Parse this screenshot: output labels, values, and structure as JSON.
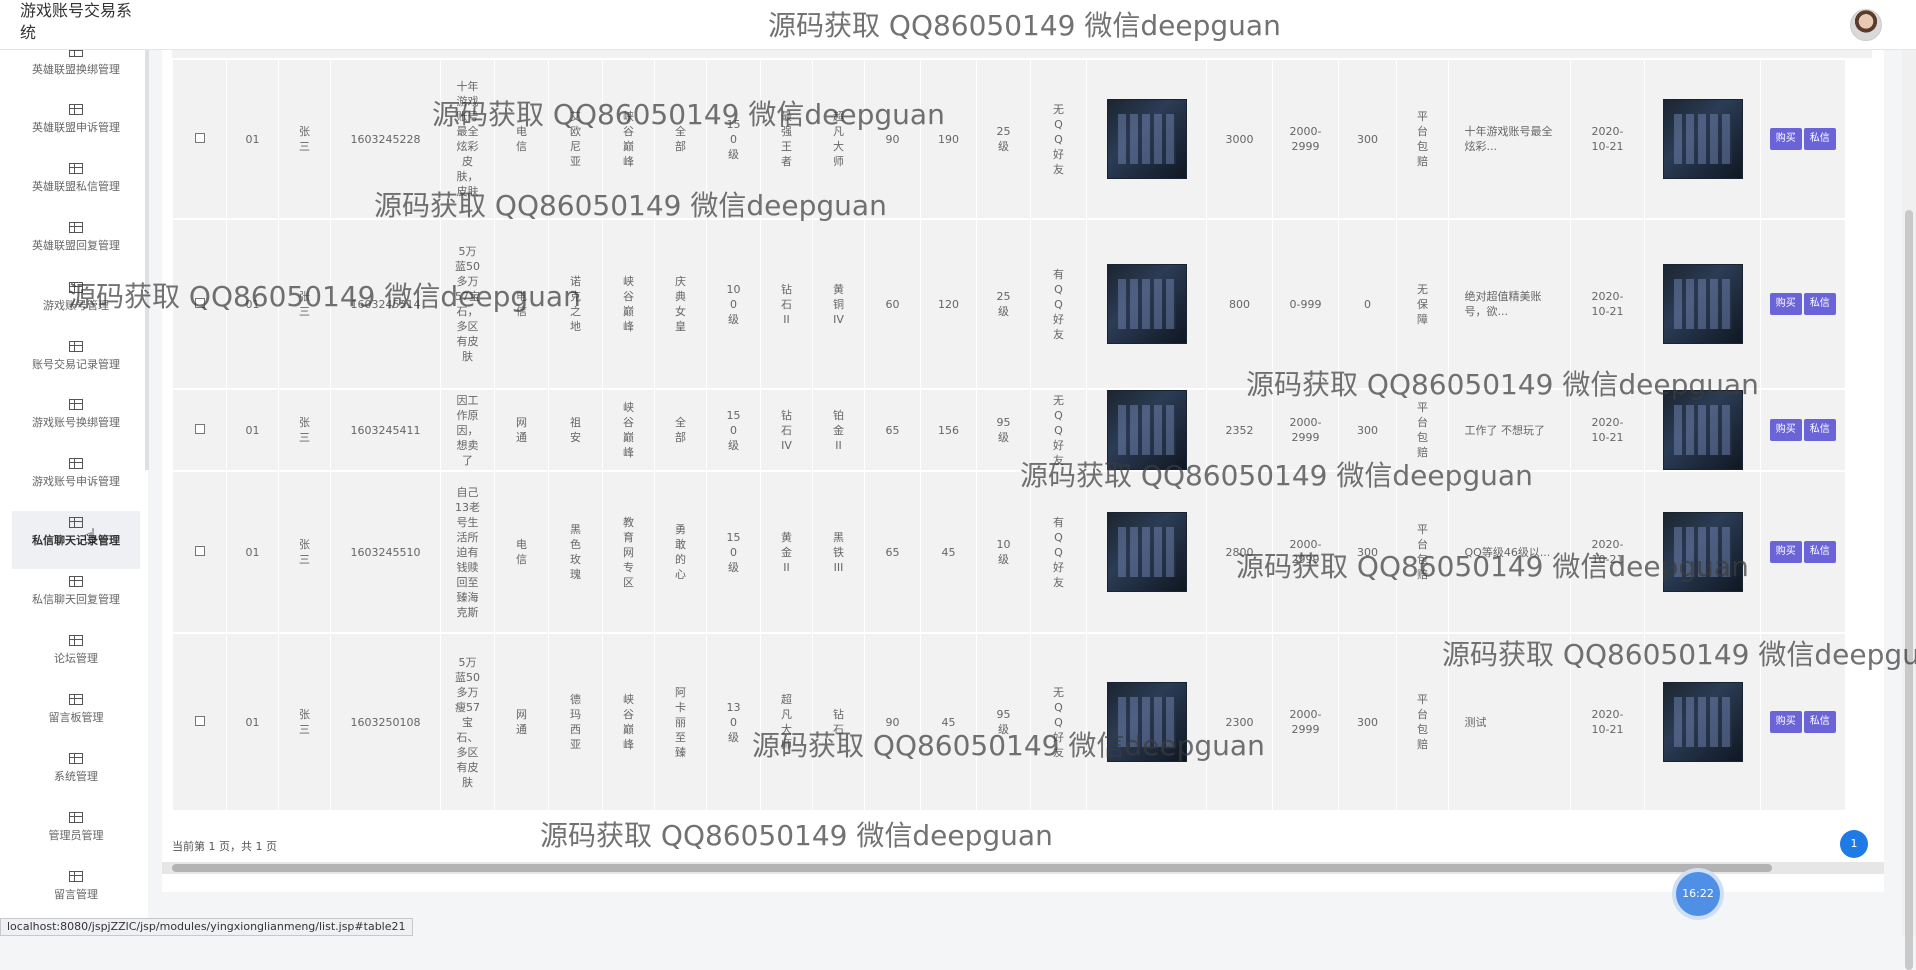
{
  "app": {
    "title": "游戏账号交易系统"
  },
  "watermark": "源码获取 QQ86050149 微信deepguan",
  "sidebar": {
    "items": [
      {
        "label": "英雄联盟换绑管理"
      },
      {
        "label": "英雄联盟申诉管理"
      },
      {
        "label": "英雄联盟私信管理"
      },
      {
        "label": "英雄联盟回复管理"
      },
      {
        "label": "游戏账号管理"
      },
      {
        "label": "账号交易记录管理"
      },
      {
        "label": "游戏账号换绑管理"
      },
      {
        "label": "游戏账号申诉管理"
      },
      {
        "label": "私信聊天记录管理"
      },
      {
        "label": "私信聊天回复管理"
      },
      {
        "label": "论坛管理"
      },
      {
        "label": "留言板管理"
      },
      {
        "label": "系统管理"
      },
      {
        "label": "管理员管理"
      },
      {
        "label": "留言管理"
      }
    ],
    "active_index": 8
  },
  "table": {
    "rows": [
      {
        "no": "01",
        "user": "张三",
        "phone": "1603245228",
        "title": "十年游戏账号最全炫彩皮肤，皮肤",
        "net": "电信",
        "area": "艾欧尼亚",
        "map": "峡谷巅峰",
        "hero": "全部",
        "level": "150级",
        "rank1": "最强王者",
        "rank2": "超凡大师",
        "num1": "90",
        "num2": "190",
        "rune": "25级",
        "friend": "无QQ好友",
        "price": "3000",
        "range": "2000-2999",
        "deposit": "300",
        "guarantee": "平台包赔",
        "desc": "十年游戏账号最全炫彩...",
        "date": "2020-10-21"
      },
      {
        "no": "01",
        "user": "张三",
        "phone": "1603245314",
        "title": "5万蓝50多万57宝石，多区有皮肤",
        "net": "电信",
        "area": "诺克之地",
        "map": "峡谷巅峰",
        "hero": "庆典女皇",
        "level": "100级",
        "rank1": "钻石II",
        "rank2": "黄铜IV",
        "num1": "60",
        "num2": "120",
        "rune": "25级",
        "friend": "有QQ好友",
        "price": "800",
        "range": "0-999",
        "deposit": "0",
        "guarantee": "无保障",
        "desc": "绝对超值精美账号，欲...",
        "date": "2020-10-21"
      },
      {
        "no": "01",
        "user": "张三",
        "phone": "1603245411",
        "title": "因工作原因，想卖了",
        "net": "网通",
        "area": "祖安",
        "map": "峡谷巅峰",
        "hero": "全部",
        "level": "150级",
        "rank1": "钻石IV",
        "rank2": "铂金II",
        "num1": "65",
        "num2": "156",
        "rune": "95级",
        "friend": "无QQ好友",
        "price": "2352",
        "range": "2000-2999",
        "deposit": "300",
        "guarantee": "平台包赔",
        "desc": "工作了 不想玩了",
        "date": "2020-10-21"
      },
      {
        "no": "01",
        "user": "张三",
        "phone": "1603245510",
        "title": "自己13老号生活所迫有钱赎回至臻海克斯",
        "net": "电信",
        "area": "黑色玫瑰",
        "map": "教育网专区",
        "hero": "勇敢的心",
        "level": "150级",
        "rank1": "黄金II",
        "rank2": "黑铁III",
        "num1": "65",
        "num2": "45",
        "rune": "10级",
        "friend": "有QQ好友",
        "price": "2800",
        "range": "2000-2999",
        "deposit": "300",
        "guarantee": "平台包赔",
        "desc": "QQ等级46级以...",
        "date": "2020-10-21"
      },
      {
        "no": "01",
        "user": "张三",
        "phone": "1603250108",
        "title": "5万蓝50多万瘦57宝石、多区有皮肤",
        "net": "网通",
        "area": "德玛西亚",
        "map": "峡谷巅峰",
        "hero": "阿卡丽至臻",
        "level": "130级",
        "rank1": "超凡大师",
        "rank2": "钻石",
        "num1": "90",
        "num2": "45",
        "rune": "95级",
        "friend": "无QQ好友",
        "price": "2300",
        "range": "2000-2999",
        "deposit": "300",
        "guarantee": "平台包赔",
        "desc": "测试",
        "date": "2020-10-21"
      }
    ],
    "buy_label": "购买",
    "msg_label": "私信"
  },
  "footer": {
    "page_info": "当前第 1 页，共 1 页",
    "page_number": "1"
  },
  "clock": "16:22",
  "status_url": "localhost:8080/jspjZZlC/jsp/modules/yingxionglianmeng/list.jsp#table21",
  "colors": {
    "button": "#6b63d8",
    "page_number": "#1e7be6"
  }
}
